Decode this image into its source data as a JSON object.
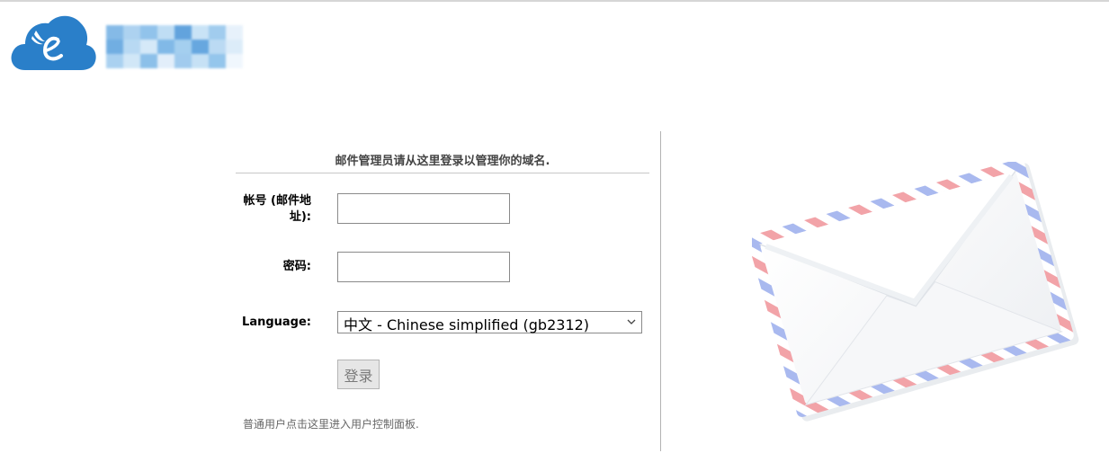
{
  "header": {
    "logo_icon": "cloud-e-logo-icon"
  },
  "login": {
    "instruction": "邮件管理员请从这里登录以管理你的域名.",
    "account_label": "帐号 (邮件地址):",
    "account_value": "",
    "password_label": "密码:",
    "password_value": "",
    "language_label": "Language:",
    "language_selected": "中文 - Chinese simplified (gb2312)",
    "login_button": "登录",
    "user_panel_link": "普通用户点击这里进入用户控制面板."
  },
  "decor": {
    "envelope_icon": "airmail-envelope-icon"
  },
  "colors": {
    "logo_blue": "#2a7fc9",
    "button_bg": "#e6e6e6",
    "divider": "#b3b3b3"
  }
}
